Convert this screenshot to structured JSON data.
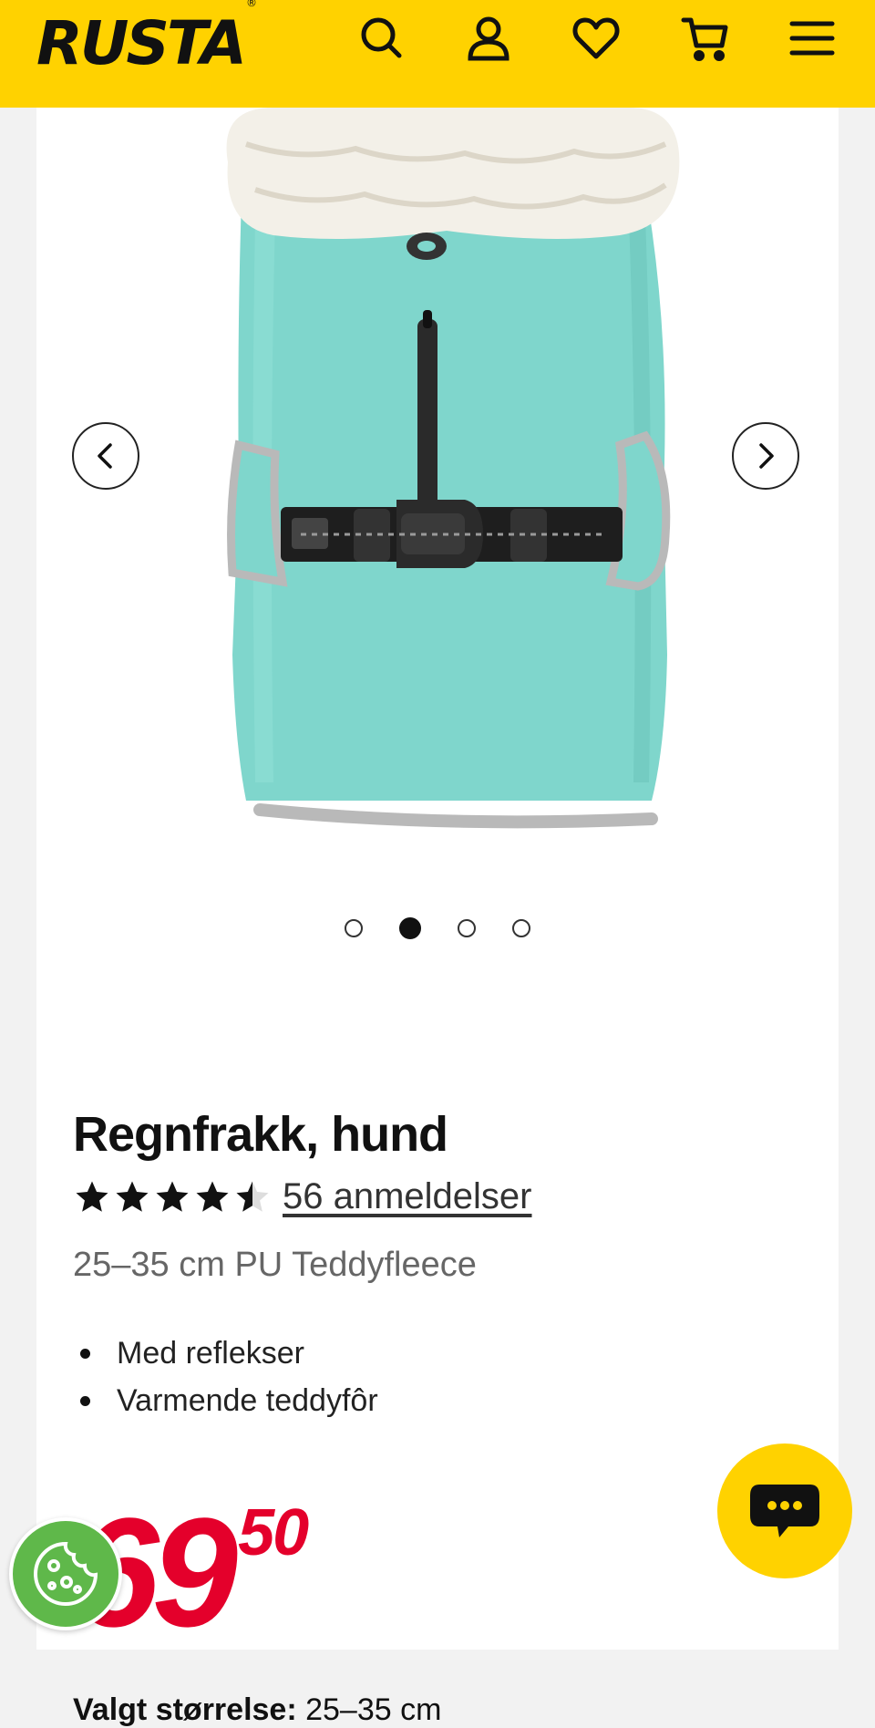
{
  "header": {
    "logo": "RUSTA",
    "logo_mark": "®",
    "icons": [
      "search-icon",
      "account-icon",
      "favorites-icon",
      "cart-icon",
      "menu-icon"
    ],
    "background": "#ffd200"
  },
  "gallery": {
    "slide_count": 4,
    "active_slide": 2
  },
  "product": {
    "title": "Regnfrakk, hund",
    "rating": 4.5,
    "rating_max": 5,
    "reviews_label": "56 anmeldelser",
    "spec": "25–35 cm PU Teddyfleece",
    "bullets": [
      "Med reflekser",
      "Varmende teddyfôr"
    ],
    "price_main": "69",
    "price_decimals": "50",
    "price_color": "#e4002b",
    "size_label": "Valgt størrelse:",
    "size_value": "25–35 cm"
  },
  "floating": {
    "chat_icon": "chat-bubble-icon",
    "cookie_icon": "cookie-icon"
  }
}
